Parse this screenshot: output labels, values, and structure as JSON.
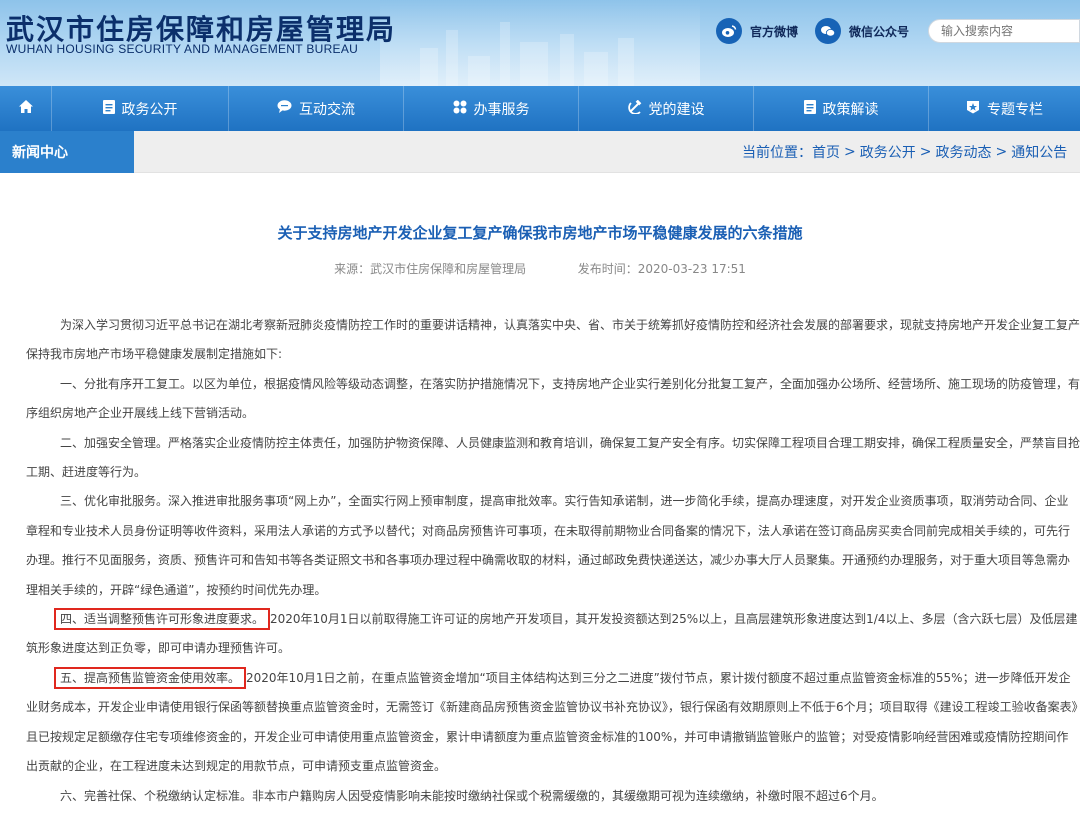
{
  "header": {
    "title": "武汉市住房保障和房屋管理局",
    "subtitle": "WUHAN HOUSING SECURITY AND MANAGEMENT BUREAU",
    "weibo_label": "官方微博",
    "wechat_label": "微信公众号",
    "search_placeholder": "输入搜索内容"
  },
  "nav": {
    "items": [
      {
        "label": "政务公开",
        "icon": "document-icon"
      },
      {
        "label": "互动交流",
        "icon": "chat-bubble-icon"
      },
      {
        "label": "办事服务",
        "icon": "grid-icon"
      },
      {
        "label": "党的建设",
        "icon": "hammer-sickle-icon"
      },
      {
        "label": "政策解读",
        "icon": "document-icon"
      },
      {
        "label": "专题专栏",
        "icon": "star-badge-icon"
      }
    ]
  },
  "subbar": {
    "section": "新闻中心",
    "breadcrumb": [
      "当前位置：首页",
      ">",
      "政务公开",
      ">",
      "政务动态",
      ">",
      "通知公告"
    ]
  },
  "article": {
    "title": "关于支持房地产开发企业复工复产确保我市房地产市场平稳健康发展的六条措施",
    "source": "来源：武汉市住房保障和房屋管理局",
    "publish_time": "发布时间：2020-03-23 17:51",
    "intro": "为深入学习贯彻习近平总书记在湖北考察新冠肺炎疫情防控工作时的重要讲话精神，认真落实中央、省、市关于统筹抓好疫情防控和经济社会发展的部署要求，现就支持房地产开发企业复工复产保持我市房地产市场平稳健康发展制定措施如下:",
    "p1": "一、分批有序开工复工。以区为单位，根据疫情风险等级动态调整，在落实防护措施情况下，支持房地产企业实行差别化分批复工复产，全面加强办公场所、经营场所、施工现场的防疫管理，有序组织房地产企业开展线上线下营销活动。",
    "p2": "二、加强安全管理。严格落实企业疫情防控主体责任，加强防护物资保障、人员健康监测和教育培训，确保复工复产安全有序。切实保障工程项目合理工期安排，确保工程质量安全，严禁盲目抢工期、赶进度等行为。",
    "p3": "三、优化审批服务。深入推进审批服务事项“网上办”，全面实行网上预审制度，提高审批效率。实行告知承诺制，进一步简化手续，提高办理速度，对开发企业资质事项，取消劳动合同、企业章程和专业技术人员身份证明等收件资料，采用法人承诺的方式予以替代；对商品房预售许可事项，在未取得前期物业合同备案的情况下，法人承诺在签订商品房买卖合同前完成相关手续的，可先行办理。推行不见面服务，资质、预售许可和告知书等各类证照文书和各事项办理过程中确需收取的材料，通过邮政免费快递送达，减少办事大厅人员聚集。开通预约办理服务，对于重大项目等急需办理相关手续的，开辟“绿色通道”，按预约时间优先办理。",
    "p4_head": "四、适当调整预售许可形象进度要求。",
    "p4_body": "2020年10月1日以前取得施工许可证的房地产开发项目，其开发投资额达到25%以上，且高层建筑形象进度达到1/4以上、多层（含六跃七层）及低层建筑形象进度达到正负零，即可申请办理预售许可。",
    "p5_head": "五、提高预售监管资金使用效率。",
    "p5_body": "2020年10月1日之前，在重点监管资金增加“项目主体结构达到三分之二进度”拨付节点，累计拨付额度不超过重点监管资金标准的55%；进一步降低开发企业财务成本，开发企业申请使用银行保函等额替换重点监管资金时，无需签订《新建商品房预售资金监管协议书补充协议》，银行保函有效期原则上不低于6个月；项目取得《建设工程竣工验收备案表》且已按规定足额缴存住宅专项维修资金的，开发企业可申请使用重点监管资金，累计申请额度为重点监管资金标准的100%，并可申请撤销监管账户的监管；对受疫情影响经营困难或疫情防控期间作出贡献的企业，在工程进度未达到规定的用款节点，可申请预支重点监管资金。",
    "p6": "六、完善社保、个税缴纳认定标准。非本市户籍购房人因受疫情影响未能按时缴纳社保或个税需缓缴的，其缓缴期可视为连续缴纳，补缴时限不超过6个月。"
  },
  "colors": {
    "nav_blue": "#2b80cc",
    "title_blue": "#1a5fb4",
    "highlight_red": "#e0281e"
  }
}
